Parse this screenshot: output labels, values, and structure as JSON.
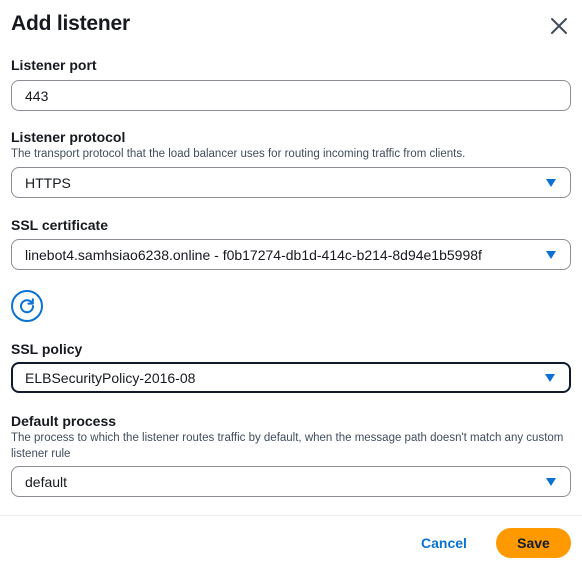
{
  "modal": {
    "title": "Add listener"
  },
  "listener_port": {
    "label": "Listener port",
    "value": "443"
  },
  "listener_protocol": {
    "label": "Listener protocol",
    "description": "The transport protocol that the load balancer uses for routing incoming traffic from clients.",
    "value": "HTTPS"
  },
  "ssl_certificate": {
    "label": "SSL certificate",
    "value": "linebot4.samhsiao6238.online - f0b17274-db1d-414c-b214-8d94e1b5998f"
  },
  "ssl_policy": {
    "label": "SSL policy",
    "value": "ELBSecurityPolicy-2016-08"
  },
  "default_process": {
    "label": "Default process",
    "description": "The process to which the listener routes traffic by default, when the message path doesn't match any custom listener rule",
    "value": "default"
  },
  "footer": {
    "cancel_label": "Cancel",
    "save_label": "Save"
  },
  "icons": {
    "close": "close-icon",
    "refresh": "refresh-icon",
    "dropdown": "caret-down-icon"
  },
  "colors": {
    "accent": "#0972d3",
    "primary_button": "#ff9900",
    "text": "#16191f",
    "border": "#8c8c94"
  }
}
